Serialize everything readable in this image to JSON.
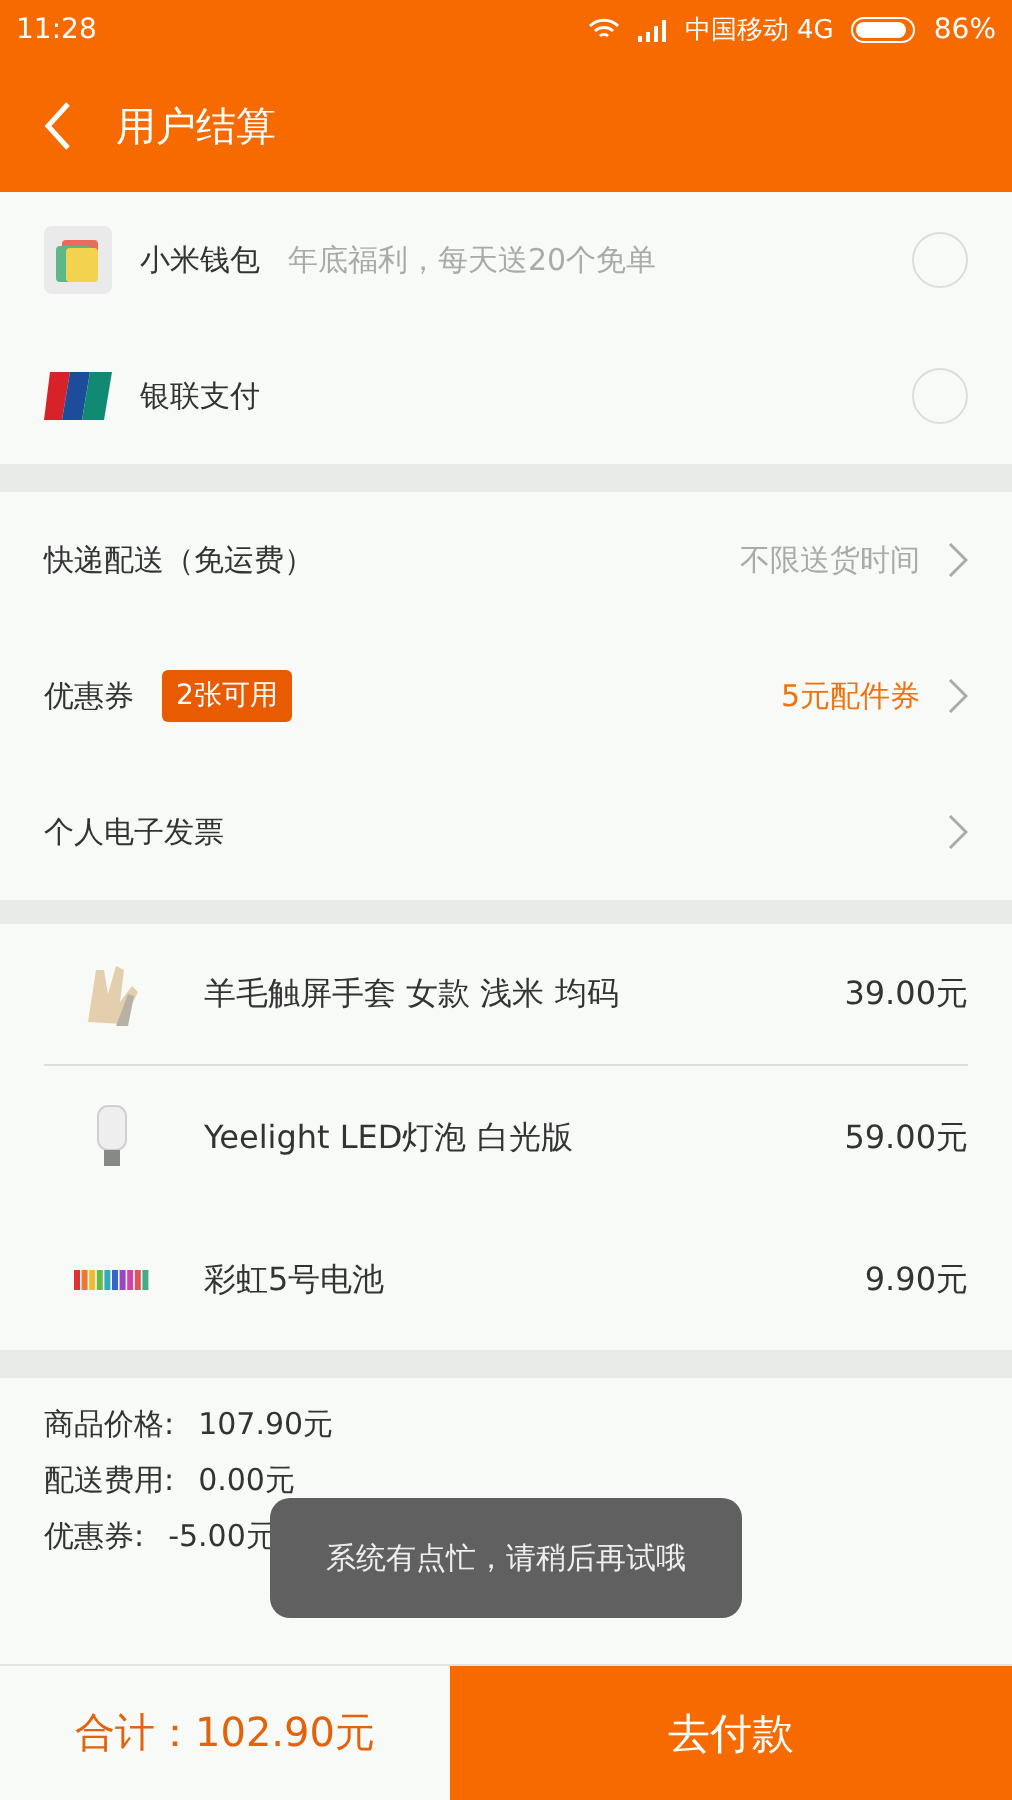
{
  "status_bar": {
    "time": "11:28",
    "carrier": "中国移动 4G",
    "battery": "86%"
  },
  "header": {
    "title": "用户结算"
  },
  "payment_methods": [
    {
      "kind": "wallet",
      "name": "小米钱包",
      "note": "年底福利，每天送20个免单",
      "selected": false
    },
    {
      "kind": "unionpay",
      "name": "银联支付",
      "selected": false
    }
  ],
  "options": [
    {
      "label": "快递配送（免运费）",
      "value": "不限送货时间",
      "color": "#aaaaaa"
    },
    {
      "label": "优惠券",
      "badge": "2张可用",
      "value": "5元配件券",
      "color": "#f0720e"
    },
    {
      "label": "个人电子发票"
    }
  ],
  "products": [
    {
      "kind": "gloves",
      "name": "羊毛触屏手套 女款 浅米 均码",
      "price": "39.00元"
    },
    {
      "kind": "bulb",
      "name": "Yeelight LED灯泡 白光版",
      "price": "59.00元"
    },
    {
      "kind": "batteries",
      "name": "彩虹5号电池",
      "price": "9.90元"
    }
  ],
  "summary": [
    {
      "label": "商品价格:",
      "value": "107.90元"
    },
    {
      "label": "配送费用:",
      "value": "0.00元"
    },
    {
      "label": "优惠券:",
      "value": "-5.00元"
    }
  ],
  "toast": "系统有点忙，请稍后再试哦",
  "footer": {
    "total": "合计：102.90元",
    "pay_button": "去付款"
  }
}
